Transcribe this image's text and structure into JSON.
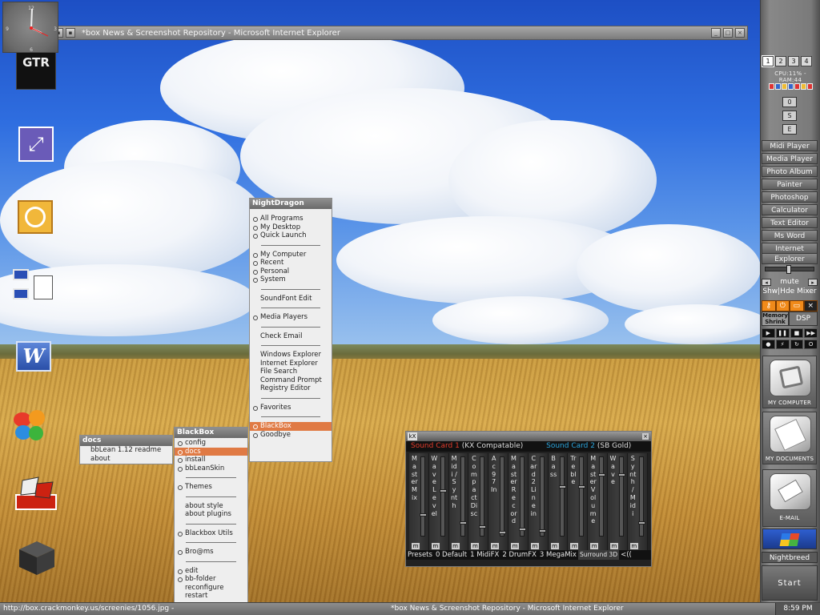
{
  "window": {
    "title": "*box News & Screenshot Repository - Microsoft Internet Explorer"
  },
  "desktop_icons": [
    {
      "name": "gtr-racing-icon",
      "text": "GTR"
    },
    {
      "name": "stretch-tool-icon"
    },
    {
      "name": "outlook-icon"
    },
    {
      "name": "network-neighborhood-icon"
    },
    {
      "name": "word-icon",
      "text": "W"
    },
    {
      "name": "msn-butterfly-icon"
    },
    {
      "name": "flag-game-icon"
    },
    {
      "name": "dark-cube-icon"
    }
  ],
  "nightdragon_menu": {
    "title": "NightDragon",
    "groups": [
      [
        "All Programs",
        "My Desktop",
        "Quick Launch"
      ],
      [
        "My Computer",
        "Recent",
        "Personal",
        "System"
      ],
      [
        "SoundFont Edit"
      ],
      [
        "Media Players"
      ],
      [
        "Check Email"
      ],
      [
        "Windows Explorer",
        "Internet Explorer",
        "File Search",
        "Command Prompt",
        "Registry Editor"
      ],
      [
        "Favorites"
      ],
      [
        "BlackBox",
        "Goodbye"
      ]
    ]
  },
  "blackbox_menu": {
    "title": "BlackBox",
    "groups": [
      [
        "config",
        "docs",
        "install",
        "bbLeanSkin"
      ],
      [
        "Themes"
      ],
      [
        "about style",
        "about plugins"
      ],
      [
        "Blackbox Utils"
      ],
      [
        "Bro@ms"
      ],
      [
        "edit",
        "bb-folder",
        "reconfigure",
        "restart"
      ]
    ]
  },
  "docs_menu": {
    "title": "docs",
    "items": [
      "bbLean 1.12 readme",
      "about"
    ]
  },
  "mixer": {
    "card1": "Sound Card 1",
    "card1_desc": "(KX Compatable)",
    "card2": "Sound Card 2",
    "card2_desc": "(SB Gold)",
    "channels": [
      "Master Mix",
      "Wave Level",
      "Midi / Synth",
      "Compact Disc",
      "Ac97 In",
      "Master Record",
      "Card2 Line in",
      "Bass",
      "Treble",
      "Master Volume",
      "Wave",
      "Synth / Midi"
    ],
    "mute_label": "m",
    "presets": [
      "Presets",
      "0 Default",
      "1 MidiFX",
      "2 DrumFX",
      "3 MegaMix",
      "Surround 3D",
      "<(("
    ]
  },
  "sidebar": {
    "workspaces": [
      "1",
      "2",
      "3",
      "4"
    ],
    "cpu_ram": "CPU:11% - RAM:44",
    "small_buttons": [
      "0",
      "S",
      "E"
    ],
    "apps": [
      "Midi Player",
      "Media Player",
      "Photo Album",
      "Painter",
      "Photoshop",
      "Calculator",
      "Text Editor",
      "Ms Word",
      "Internet",
      "Explorer"
    ],
    "mute": "mute",
    "mixer_toggle": "Shw|Hde Mixer",
    "memory_shrink": "Memory Shrink",
    "dsp": "DSP",
    "big_icons": [
      "MY COMPUTER",
      "MY DOCUMENTS",
      "E-MAIL"
    ],
    "user": "Nightbreed",
    "start": "Start"
  },
  "taskbar": {
    "status_url": "http://box.crackmonkey.us/screenies/1056.jpg - ",
    "task": "*box News & Screenshot Repository - Microsoft Internet Explorer",
    "clock": "8:59 PM"
  }
}
